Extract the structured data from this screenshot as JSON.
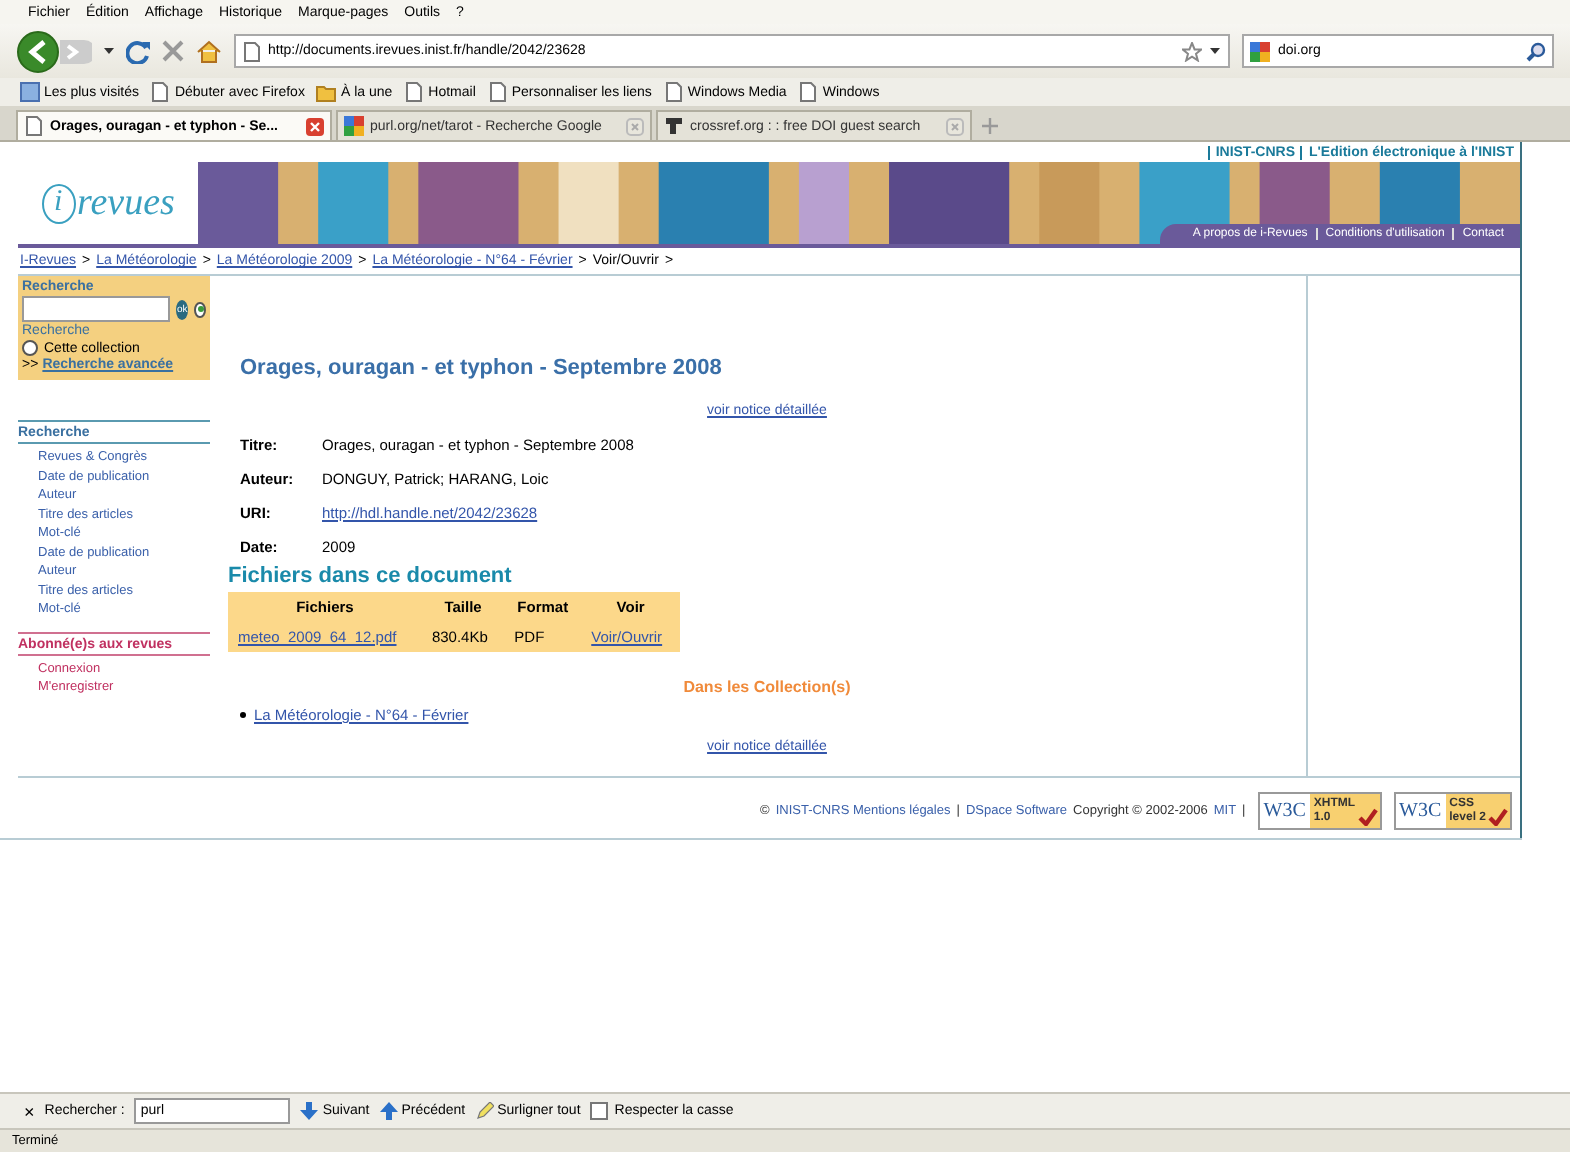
{
  "browser": {
    "menu": [
      "Fichier",
      "Édition",
      "Affichage",
      "Historique",
      "Marque-pages",
      "Outils",
      "?"
    ],
    "url": "http://documents.irevues.inist.fr/handle/2042/23628",
    "search_value": "doi.org",
    "bookmarks": [
      {
        "label": "Les plus visités",
        "kind": "star"
      },
      {
        "label": "Débuter avec Firefox",
        "kind": "page"
      },
      {
        "label": "À la une",
        "kind": "feed"
      },
      {
        "label": "Hotmail",
        "kind": "page"
      },
      {
        "label": "Personnaliser les liens",
        "kind": "page"
      },
      {
        "label": "Windows Media",
        "kind": "page"
      },
      {
        "label": "Windows",
        "kind": "page"
      }
    ],
    "tabs": [
      {
        "label": "Orages, ouragan - et typhon - Se...",
        "selected": true,
        "kind": "page"
      },
      {
        "label": "purl.org/net/tarot - Recherche Google",
        "selected": false,
        "kind": "google"
      },
      {
        "label": "crossref.org : : free DOI guest search",
        "selected": false,
        "kind": "crossref"
      }
    ]
  },
  "page": {
    "header_links": [
      "INIST-CNRS",
      "L'Edition électronique à l'INIST"
    ],
    "logo": {
      "mark": "i",
      "text": "revues"
    },
    "banner_links": [
      "A propos de i-Revues",
      "Conditions d'utilisation",
      "Contact"
    ],
    "breadcrumb": {
      "separator": ">",
      "items": [
        {
          "label": "I-Revues",
          "link": true
        },
        {
          "label": "La Météorologie",
          "link": true
        },
        {
          "label": "La Météorologie 2009",
          "link": true
        },
        {
          "label": "La Météorologie - N°64 - Février",
          "link": true
        },
        {
          "label": "Voir/Ouvrir",
          "link": false
        }
      ]
    },
    "sidebar": {
      "search": {
        "heading": "Recherche",
        "button": "ok",
        "scopes": [
          {
            "label": "Recherche",
            "selected": true
          },
          {
            "label": "Cette collection",
            "selected": false
          }
        ],
        "advanced_prefix": ">>",
        "advanced": "Recherche avancée"
      },
      "sections": [
        {
          "heading": "Recherche",
          "kind": "browse",
          "items": [
            "Revues & Congrès",
            "Date de publication",
            "Auteur",
            "Titre des articles",
            "Mot-clé",
            "Date de publication",
            "Auteur",
            "Titre des articles",
            "Mot-clé"
          ]
        },
        {
          "heading": "Abonné(e)s aux revues",
          "kind": "account",
          "items": [
            "Connexion",
            "M'enregistrer"
          ]
        }
      ]
    },
    "main": {
      "title": "Orages, ouragan - et typhon - Septembre 2008",
      "detail_link": "voir notice détaillée",
      "metadata": [
        {
          "label": "Titre:",
          "value": "Orages, ouragan - et typhon - Septembre 2008",
          "link": false
        },
        {
          "label": "Auteur:",
          "value": "DONGUY, Patrick; HARANG, Loic",
          "link": false
        },
        {
          "label": "URI:",
          "value": "http://hdl.handle.net/2042/23628",
          "link": true
        },
        {
          "label": "Date:",
          "value": "2009",
          "link": false
        }
      ],
      "files_heading": "Fichiers dans ce document",
      "files": {
        "columns": [
          "Fichiers",
          "Taille",
          "Format",
          "Voir"
        ],
        "rows": [
          [
            "meteo_2009_64_12.pdf",
            "830.4Kb",
            "PDF",
            "Voir/Ouvrir"
          ]
        ]
      },
      "collections_heading": "Dans les Collection(s)",
      "collections": [
        "La Météorologie - N°64 - Février"
      ],
      "detail_link_bottom": "voir notice détaillée"
    },
    "footer": {
      "segments": [
        {
          "text": "©",
          "link": false
        },
        {
          "text": "INIST-CNRS Mentions légales",
          "link": true
        },
        {
          "text": "|",
          "link": false
        },
        {
          "text": "DSpace Software",
          "link": true
        },
        {
          "text": "Copyright © 2002-2006",
          "link": false
        },
        {
          "text": "MIT",
          "link": true
        },
        {
          "text": "|",
          "link": false
        }
      ],
      "badges": [
        {
          "logo": "W3C",
          "label": "XHTML",
          "version": "1.0"
        },
        {
          "logo": "W3C",
          "label": "CSS",
          "version": "level 2"
        }
      ]
    }
  },
  "find_bar": {
    "close": "×",
    "label": "Rechercher :",
    "value": "purl",
    "buttons": [
      {
        "label": "Suivant",
        "kind": "down"
      },
      {
        "label": "Précédent",
        "kind": "up"
      },
      {
        "label": "Surligner tout",
        "kind": "highlight"
      }
    ],
    "match_case": {
      "label": "Respecter la casse",
      "checked": false
    }
  },
  "status": "Terminé"
}
